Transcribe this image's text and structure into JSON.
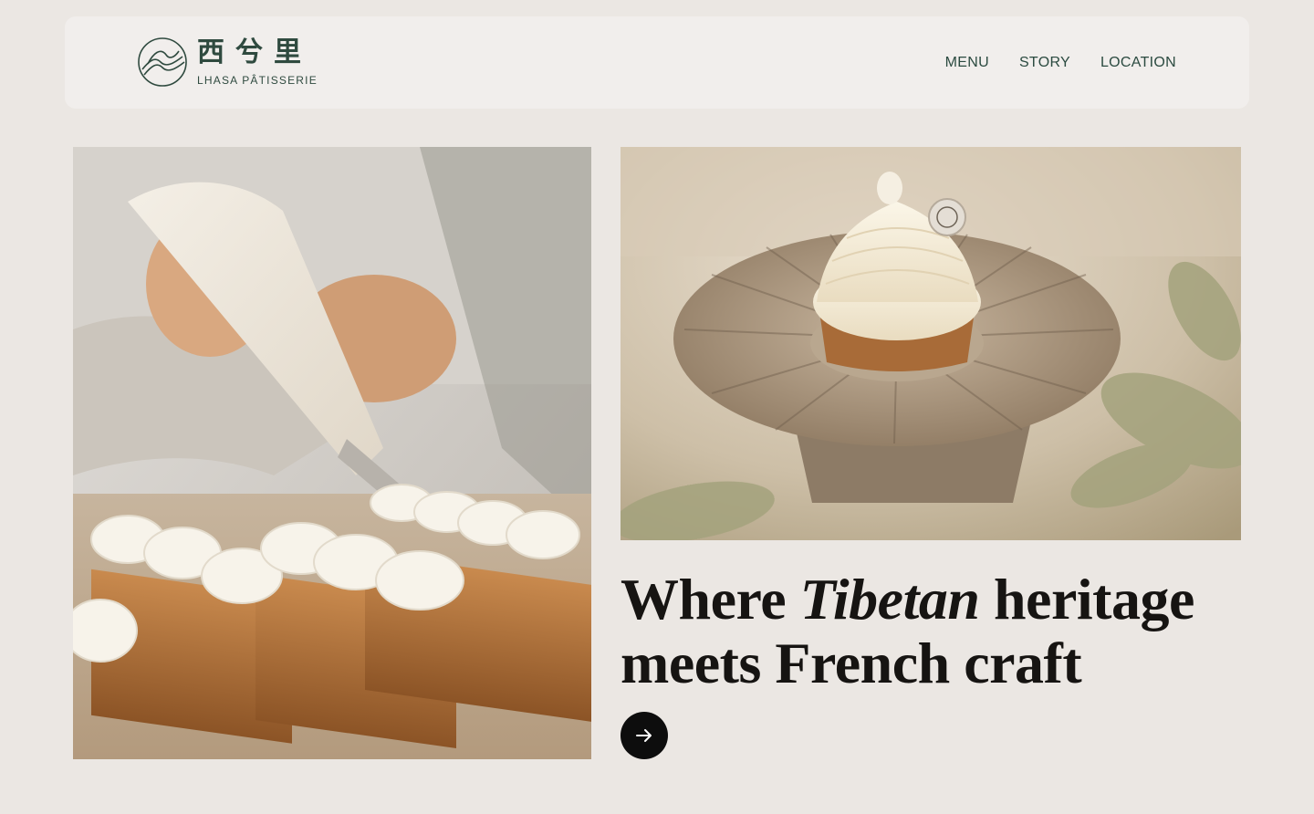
{
  "brand": {
    "name_cn": "西兮里",
    "name_en": "LHASA PÂTISSERIE",
    "color": "#2f4a3f"
  },
  "nav": {
    "items": [
      {
        "label": "MENU"
      },
      {
        "label": "STORY"
      },
      {
        "label": "LOCATION"
      }
    ]
  },
  "hero": {
    "headline_pre": "Where ",
    "headline_em": "Tibetan",
    "headline_post1": " heritage",
    "headline_line2": "meets French craft",
    "cta_icon": "arrow-right-icon"
  },
  "images": {
    "left": "chef-piping-cream-photo",
    "right": "cream-tart-on-plate-photo"
  },
  "colors": {
    "background": "#ebe7e3",
    "header_bg": "#f1eeec",
    "cta_bg": "#0d0d0d"
  }
}
